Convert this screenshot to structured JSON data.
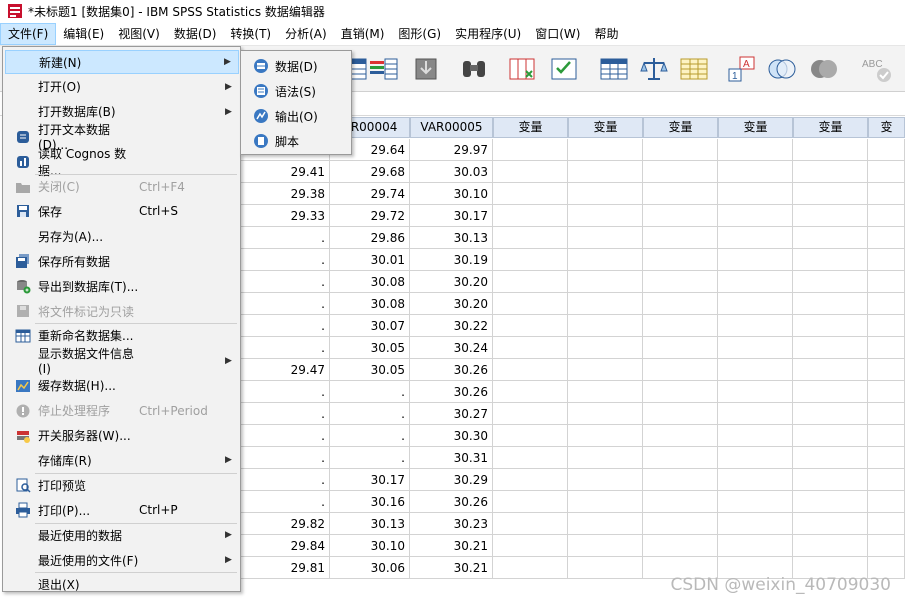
{
  "window": {
    "title": "*未标题1 [数据集0] - IBM SPSS Statistics 数据编辑器"
  },
  "menubar": {
    "items": [
      "文件(F)",
      "编辑(E)",
      "视图(V)",
      "数据(D)",
      "转换(T)",
      "分析(A)",
      "直销(M)",
      "图形(G)",
      "实用程序(U)",
      "窗口(W)",
      "帮助"
    ]
  },
  "file_menu": {
    "items": [
      {
        "label": "新建(N)",
        "shortcut": "",
        "submenu": true,
        "disabled": false,
        "icon": "none"
      },
      {
        "label": "打开(O)",
        "shortcut": "",
        "submenu": true,
        "disabled": false,
        "icon": "none"
      },
      {
        "label": "打开数据库(B)",
        "shortcut": "",
        "submenu": true,
        "disabled": false,
        "icon": "none"
      },
      {
        "label": "打开文本数据(D)...",
        "shortcut": "",
        "submenu": false,
        "disabled": false,
        "icon": "text-data-icon"
      },
      {
        "label": "读取 Cognos 数据...",
        "shortcut": "",
        "submenu": false,
        "disabled": false,
        "icon": "cognos-icon"
      },
      {
        "label": "关闭(C)",
        "shortcut": "Ctrl+F4",
        "submenu": false,
        "disabled": true,
        "icon": "folder-icon"
      },
      {
        "label": "保存",
        "shortcut": "Ctrl+S",
        "submenu": false,
        "disabled": false,
        "icon": "save-icon"
      },
      {
        "label": "另存为(A)...",
        "shortcut": "",
        "submenu": false,
        "disabled": false,
        "icon": "none"
      },
      {
        "label": "保存所有数据",
        "shortcut": "",
        "submenu": false,
        "disabled": false,
        "icon": "save-all-icon"
      },
      {
        "label": "导出到数据库(T)...",
        "shortcut": "",
        "submenu": false,
        "disabled": false,
        "icon": "export-db-icon"
      },
      {
        "label": "将文件标记为只读",
        "shortcut": "",
        "submenu": false,
        "disabled": true,
        "icon": "readonly-icon"
      },
      {
        "label": "重新命名数据集...",
        "shortcut": "",
        "submenu": false,
        "disabled": false,
        "icon": "rename-icon"
      },
      {
        "label": "显示数据文件信息(I)",
        "shortcut": "",
        "submenu": true,
        "disabled": false,
        "icon": "none"
      },
      {
        "label": "缓存数据(H)...",
        "shortcut": "",
        "submenu": false,
        "disabled": false,
        "icon": "cache-icon"
      },
      {
        "label": "停止处理程序",
        "shortcut": "Ctrl+Period",
        "submenu": false,
        "disabled": true,
        "icon": "stop-icon"
      },
      {
        "label": "开关服务器(W)...",
        "shortcut": "",
        "submenu": false,
        "disabled": false,
        "icon": "server-icon"
      },
      {
        "label": "存储库(R)",
        "shortcut": "",
        "submenu": true,
        "disabled": false,
        "icon": "none"
      },
      {
        "label": "打印预览",
        "shortcut": "",
        "submenu": false,
        "disabled": false,
        "icon": "print-preview-icon"
      },
      {
        "label": "打印(P)...",
        "shortcut": "Ctrl+P",
        "submenu": false,
        "disabled": false,
        "icon": "print-icon"
      },
      {
        "label": "最近使用的数据",
        "shortcut": "",
        "submenu": true,
        "disabled": false,
        "icon": "none"
      },
      {
        "label": "最近使用的文件(F)",
        "shortcut": "",
        "submenu": true,
        "disabled": false,
        "icon": "none"
      },
      {
        "label": "退出(X)",
        "shortcut": "",
        "submenu": false,
        "disabled": false,
        "icon": "none"
      }
    ]
  },
  "new_submenu": {
    "items": [
      "数据(D)",
      "语法(S)",
      "输出(O)",
      "脚本"
    ]
  },
  "grid": {
    "headers": [
      "AR00004",
      "VAR00005",
      "变量",
      "变量",
      "变量",
      "变量",
      "变量",
      "变量",
      "变"
    ],
    "col3": [
      "",
      "29.41",
      "29.38",
      "29.33",
      ".",
      ".",
      ".",
      ".",
      ".",
      ".",
      "29.47",
      ".",
      ".",
      ".",
      ".",
      ".",
      ".",
      "29.82",
      "29.84",
      "29.81"
    ],
    "col4": [
      "29.64",
      "29.68",
      "29.74",
      "29.72",
      "29.86",
      "30.01",
      "30.08",
      "30.08",
      "30.07",
      "30.05",
      "30.05",
      ".",
      ".",
      ".",
      ".",
      "30.17",
      "30.16",
      "30.13",
      "30.10",
      "30.06"
    ],
    "col5": [
      "29.97",
      "30.03",
      "30.10",
      "30.17",
      "30.13",
      "30.19",
      "30.20",
      "30.20",
      "30.22",
      "30.24",
      "30.26",
      "30.26",
      "30.27",
      "30.30",
      "30.31",
      "30.29",
      "30.26",
      "30.23",
      "30.21",
      "30.21"
    ]
  },
  "watermark": "CSDN @weixin_40709030"
}
